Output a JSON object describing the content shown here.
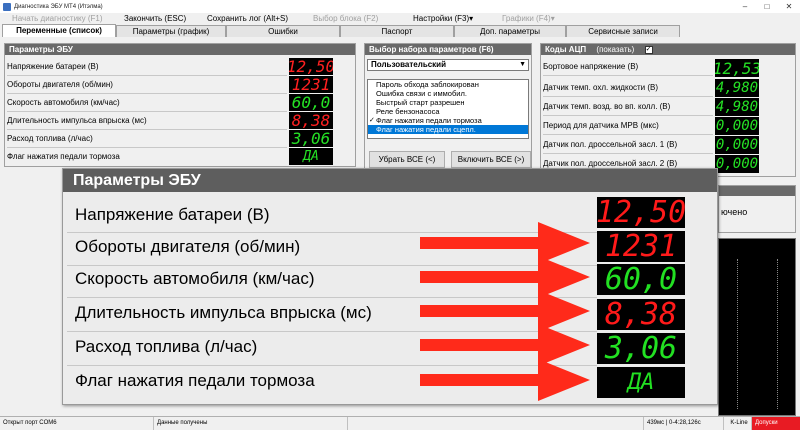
{
  "window": {
    "title": "Диагностика ЭБУ МТ4 (Итэлма)",
    "min": "–",
    "max": "□",
    "close": "✕"
  },
  "menu": [
    {
      "label": "Начать диагностику (F1)",
      "enabled": false
    },
    {
      "label": "Закончить (ESC)",
      "enabled": true
    },
    {
      "label": "Сохранить лог (Alt+S)",
      "enabled": true
    },
    {
      "label": "Выбор блока (F2)",
      "enabled": false
    },
    {
      "label": "Настройки (F3)▾",
      "enabled": true
    },
    {
      "label": "Графики (F4)▾",
      "enabled": false
    }
  ],
  "tabs": [
    "Переменные (список)",
    "Параметры (график)",
    "Ошибки",
    "Паспорт",
    "Доп. параметры",
    "Сервисные записи"
  ],
  "ecu_panel": {
    "title": "Параметры ЭБУ",
    "rows": [
      {
        "label": "Напряжение батареи (В)",
        "value": "12,50",
        "color": "red"
      },
      {
        "label": "Обороты двигателя (об/мин)",
        "value": "1231",
        "color": "red"
      },
      {
        "label": "Скорость автомобиля (км/час)",
        "value": "60,0",
        "color": "green"
      },
      {
        "label": "Длительность импульса впрыска (мс)",
        "value": "8,38",
        "color": "red"
      },
      {
        "label": "Расход топлива (л/час)",
        "value": "3,06",
        "color": "green"
      },
      {
        "label": "Флаг нажатия педали тормоза",
        "value": "ДА",
        "color": "green"
      }
    ]
  },
  "param_set": {
    "title": "Выбор набора параметров (F6)",
    "selected": "Пользовательский",
    "items": [
      {
        "label": "Пароль обхода заблокирован",
        "checked": false,
        "selected": false
      },
      {
        "label": "Ошибка связи с иммобил.",
        "checked": false,
        "selected": false
      },
      {
        "label": "Быстрый старт разрешен",
        "checked": false,
        "selected": false
      },
      {
        "label": "Реле бензонасоса",
        "checked": false,
        "selected": false
      },
      {
        "label": "Флаг нажатия педали тормоза",
        "checked": true,
        "selected": false
      },
      {
        "label": "Флаг нажатия педали сцепл.",
        "checked": false,
        "selected": true
      }
    ],
    "remove_all": "Убрать ВСЕ (<)",
    "include_all": "Включить ВСЕ (>)"
  },
  "adc": {
    "title": "Коды АЦП",
    "show_label": "(показать)",
    "show_checked": true,
    "rows": [
      {
        "label": "Бортовое напряжение (В)",
        "value": "12,53"
      },
      {
        "label": "Датчик темп. охл. жидкости (В)",
        "value": "4,980"
      },
      {
        "label": "Датчик темп. возд. во вп. колл. (В)",
        "value": "4,980"
      },
      {
        "label": "Период для датчика МРВ (мкс)",
        "value": "0,000"
      },
      {
        "label": "Датчик пол. дроссельной засл. 1 (В)",
        "value": "0,000"
      },
      {
        "label": "Датчик пол. дроссельной засл. 2 (В)",
        "value": "0,000"
      }
    ],
    "behind_text": "ючено"
  },
  "zoom": {
    "title": "Параметры ЭБУ",
    "rows": [
      {
        "label": "Напряжение батареи (В)",
        "value": "12,50",
        "color": "red",
        "arrow": false
      },
      {
        "label": "Обороты двигателя (об/мин)",
        "value": "1231",
        "color": "red",
        "arrow": true
      },
      {
        "label": "Скорость автомобиля (км/час)",
        "value": "60,0",
        "color": "green",
        "arrow": true
      },
      {
        "label": "Длительность импульса впрыска (мс)",
        "value": "8,38",
        "color": "red",
        "arrow": true
      },
      {
        "label": "Расход топлива (л/час)",
        "value": "3,06",
        "color": "green",
        "arrow": true
      },
      {
        "label": "Флаг нажатия педали тормоза",
        "value": "ДА",
        "color": "green",
        "arrow": true
      }
    ]
  },
  "status": {
    "port": "Открыт порт COM6",
    "data": "Данные получены",
    "timing": "439мс | 0-4:28,126с",
    "protocol": "K-Line",
    "error": "Допуски"
  },
  "colors": {
    "lcd_red": "#ff2020",
    "lcd_green": "#25e025",
    "panel_header": "#696969",
    "arrow": "#ff2a1a",
    "selection": "#0078d7"
  }
}
